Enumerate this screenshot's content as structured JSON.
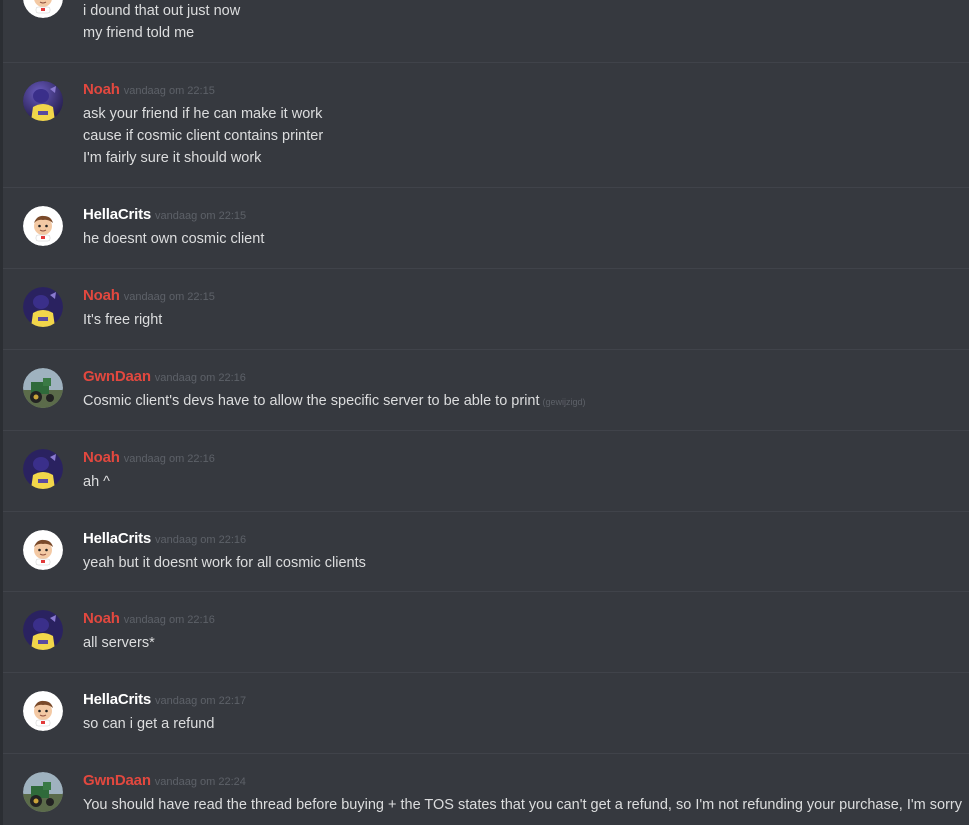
{
  "messages": [
    {
      "author": "",
      "timestamp": "",
      "author_color": "#ffffff",
      "avatar": "hellacrits-avatar",
      "lines": [
        "i dound that out just now",
        "my friend told me"
      ],
      "edited": ""
    },
    {
      "author": "Noah",
      "timestamp": "vandaag om 22:15",
      "author_color": "#e2483f",
      "avatar": "noah-avatar",
      "lines": [
        "ask your friend if he can make it work",
        "cause if cosmic client contains printer",
        "I'm fairly sure it should work"
      ],
      "edited": ""
    },
    {
      "author": "HellaCrits",
      "timestamp": "vandaag om 22:15",
      "author_color": "#ffffff",
      "avatar": "hellacrits-avatar",
      "lines": [
        "he doesnt own cosmic client"
      ],
      "edited": ""
    },
    {
      "author": "Noah",
      "timestamp": "vandaag om 22:15",
      "author_color": "#e2483f",
      "avatar": "noah-avatar",
      "lines": [
        "It's free right"
      ],
      "edited": ""
    },
    {
      "author": "GwnDaan",
      "timestamp": "vandaag om 22:16",
      "author_color": "#e2483f",
      "avatar": "gwndaan-avatar",
      "lines": [
        "Cosmic client's devs have to allow the specific server to be able to print"
      ],
      "edited": "(gewijzigd)"
    },
    {
      "author": "Noah",
      "timestamp": "vandaag om 22:16",
      "author_color": "#e2483f",
      "avatar": "noah-avatar",
      "lines": [
        "ah ^"
      ],
      "edited": ""
    },
    {
      "author": "HellaCrits",
      "timestamp": "vandaag om 22:16",
      "author_color": "#ffffff",
      "avatar": "hellacrits-avatar",
      "lines": [
        "yeah but it doesnt work for all cosmic clients"
      ],
      "edited": ""
    },
    {
      "author": "Noah",
      "timestamp": "vandaag om 22:16",
      "author_color": "#e2483f",
      "avatar": "noah-avatar",
      "lines": [
        "all servers*"
      ],
      "edited": ""
    },
    {
      "author": "HellaCrits",
      "timestamp": "vandaag om 22:17",
      "author_color": "#ffffff",
      "avatar": "hellacrits-avatar",
      "lines": [
        "so can i get a refund"
      ],
      "edited": ""
    },
    {
      "author": "GwnDaan",
      "timestamp": "vandaag om 22:24",
      "author_color": "#e2483f",
      "avatar": "gwndaan-avatar",
      "lines": [
        "You should have read the thread before buying + the TOS states that you can't get a refund, so I'm not refunding your purchase, I'm sorry"
      ],
      "edited": ""
    }
  ]
}
